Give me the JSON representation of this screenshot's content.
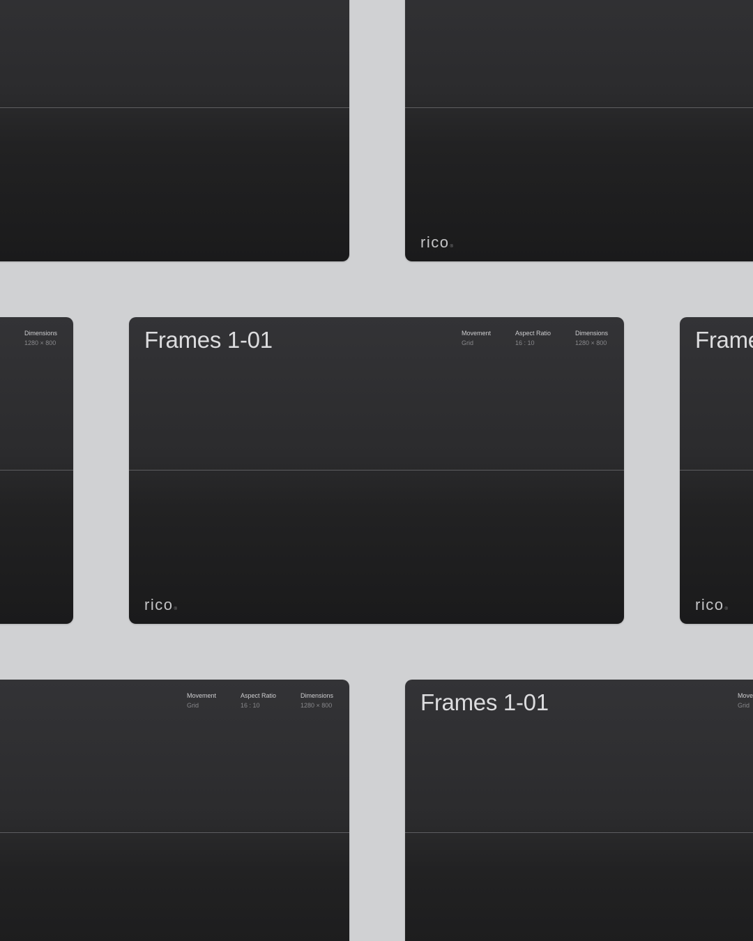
{
  "frame": {
    "title": "Frames 1-01",
    "meta": [
      {
        "label": "Movement",
        "value": "Grid"
      },
      {
        "label": "Aspect Ratio",
        "value": "16 : 10"
      },
      {
        "label": "Dimensions",
        "value": "1280 × 800"
      }
    ],
    "logo": "rico",
    "logo_mark": "®"
  },
  "colors": {
    "background": "#d0d1d3",
    "frame_top": "#333336",
    "frame_bottom": "#1a1a1b",
    "divider": "#5e5e61",
    "title_text": "#dcdcde"
  }
}
